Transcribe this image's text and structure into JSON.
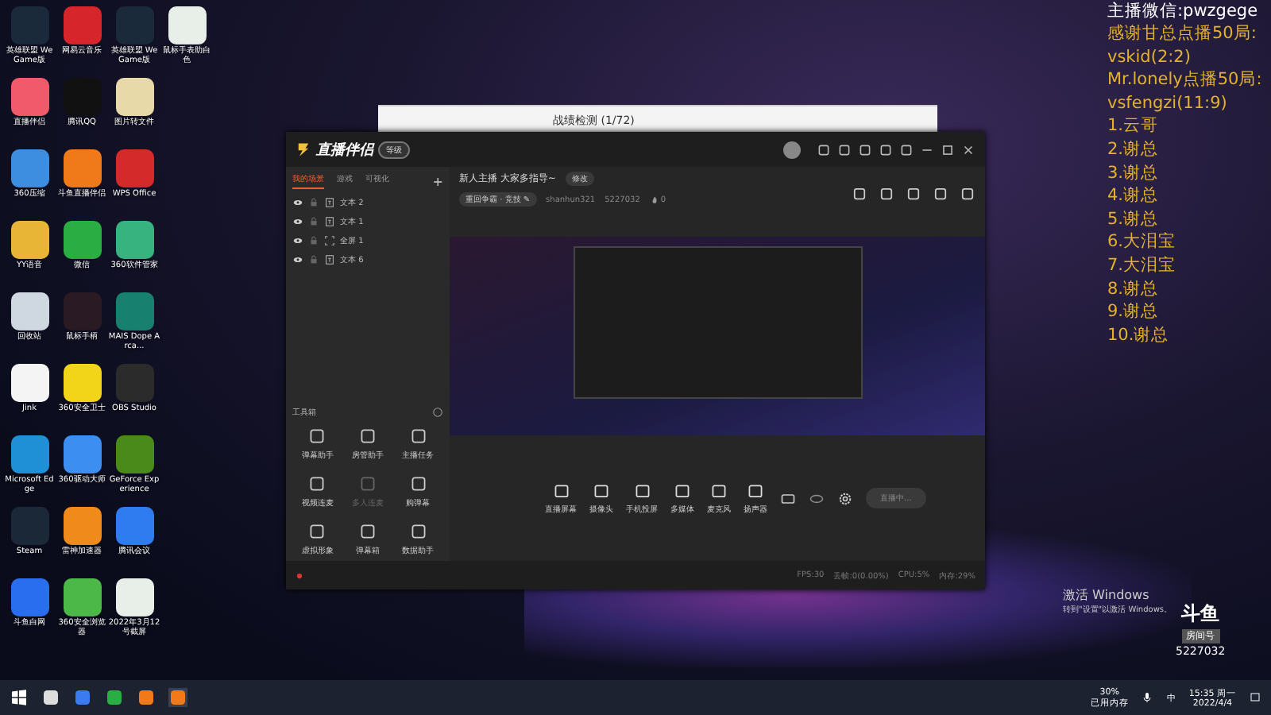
{
  "desktop_icons": [
    {
      "label": "英雄联盟 WeGame版",
      "color": "#1a2a3a"
    },
    {
      "label": "网易云音乐",
      "color": "#d6262b"
    },
    {
      "label": "英雄联盟 WeGame版",
      "color": "#1a2a3a"
    },
    {
      "label": "鼠标手表助白色",
      "color": "#e8efe9"
    },
    {
      "label": "直播伴侣",
      "color": "#f05a6a"
    },
    {
      "label": "腾讯QQ",
      "color": "#111111"
    },
    {
      "label": "图片转文件",
      "color": "#e8d9a8"
    },
    {
      "label": "360压缩",
      "color": "#3d8ee0"
    },
    {
      "label": "斗鱼直播伴侣",
      "color": "#f07a1a"
    },
    {
      "label": "WPS Office",
      "color": "#d42a2a"
    },
    {
      "label": "YY语音",
      "color": "#e9b536"
    },
    {
      "label": "微信",
      "color": "#2aae43"
    },
    {
      "label": "360软件管家",
      "color": "#36b37e"
    },
    {
      "label": "回收站",
      "color": "#cfd8e0"
    },
    {
      "label": "鼠标手柄",
      "color": "#2a1a24"
    },
    {
      "label": "MAIS Dope Arca...",
      "color": "#17806e"
    },
    {
      "label": "Jink",
      "color": "#f4f4f4"
    },
    {
      "label": "360安全卫士",
      "color": "#f2d418"
    },
    {
      "label": "OBS Studio",
      "color": "#2b2b2b"
    },
    {
      "label": "Microsoft Edge",
      "color": "#1f8fd6"
    },
    {
      "label": "360驱动大师",
      "color": "#3c8ff0"
    },
    {
      "label": "GeForce Experience",
      "color": "#4a8a1a"
    },
    {
      "label": "Steam",
      "color": "#1b2838"
    },
    {
      "label": "雷神加速器",
      "color": "#f08a1a"
    },
    {
      "label": "腾讯会议",
      "color": "#2f7bf0"
    },
    {
      "label": "斗鱼白网",
      "color": "#2a6ef0"
    },
    {
      "label": "360安全浏览器",
      "color": "#4cb848"
    },
    {
      "label": "2022年3月12号截屏",
      "color": "#e8efe9"
    }
  ],
  "back_window": {
    "title": "战绩检测 (1/72)"
  },
  "app": {
    "name": "直播伴侣",
    "level_badge": "等级",
    "tabs": [
      {
        "label": "我的场景",
        "selected": true
      },
      {
        "label": "游戏",
        "selected": false
      },
      {
        "label": "可视化",
        "selected": false
      }
    ],
    "add": "+",
    "layers": [
      {
        "name": "文本 2",
        "kind": "text",
        "visible": true
      },
      {
        "name": "文本 1",
        "kind": "text",
        "visible": true
      },
      {
        "name": "全屏 1",
        "kind": "screen",
        "visible": true
      },
      {
        "name": "文本 6",
        "kind": "text",
        "visible": true
      }
    ],
    "stream_title": "新人主播 大家多指导~",
    "edit_button": "修改",
    "category": "重回争霸 · 竞技 ✎",
    "username": "shanhun321",
    "room_id": "5227032",
    "heat": "0",
    "toolbox": {
      "title": "工具箱",
      "tools": [
        {
          "label": "弹幕助手",
          "disabled": false
        },
        {
          "label": "房管助手",
          "disabled": false
        },
        {
          "label": "主播任务",
          "disabled": false
        },
        {
          "label": "视频连麦",
          "disabled": false
        },
        {
          "label": "多人连麦",
          "disabled": true
        },
        {
          "label": "购弹幕",
          "disabled": false
        },
        {
          "label": "虚拟形象",
          "disabled": false
        },
        {
          "label": "弹幕箱",
          "disabled": false
        },
        {
          "label": "数据助手",
          "disabled": false
        }
      ]
    },
    "sources": [
      "直播屏幕",
      "摄像头",
      "手机投屏",
      "多媒体",
      "麦克风",
      "扬声器"
    ],
    "live_button": "直播中...",
    "status": [
      "FPS:30",
      "丢帧:0(0.00%)",
      "CPU:5%",
      "内存:29%"
    ]
  },
  "overlay": {
    "wechat": "主播微信:pwzgege",
    "lines": [
      "感谢甘总点播50局:",
      "vskid(2:2)",
      "Mr.lonely点播50局:",
      "vsfengzi(11:9)",
      "1.云哥",
      "2.谢总",
      "3.谢总",
      "4.谢总",
      "5.谢总",
      "6.大泪宝",
      "7.大泪宝",
      "8.谢总",
      "9.谢总",
      "10.谢总"
    ]
  },
  "activation": {
    "title": "激活 Windows",
    "hint": "转到\"设置\"以激活 Windows。"
  },
  "room_logo": {
    "brand": "斗鱼",
    "label": "房间号",
    "number": "5227032"
  },
  "taskbar": {
    "memory": "30%",
    "memory_label": "已用内存",
    "ime": "中",
    "time": "15:35 周一",
    "date": "2022/4/4"
  }
}
